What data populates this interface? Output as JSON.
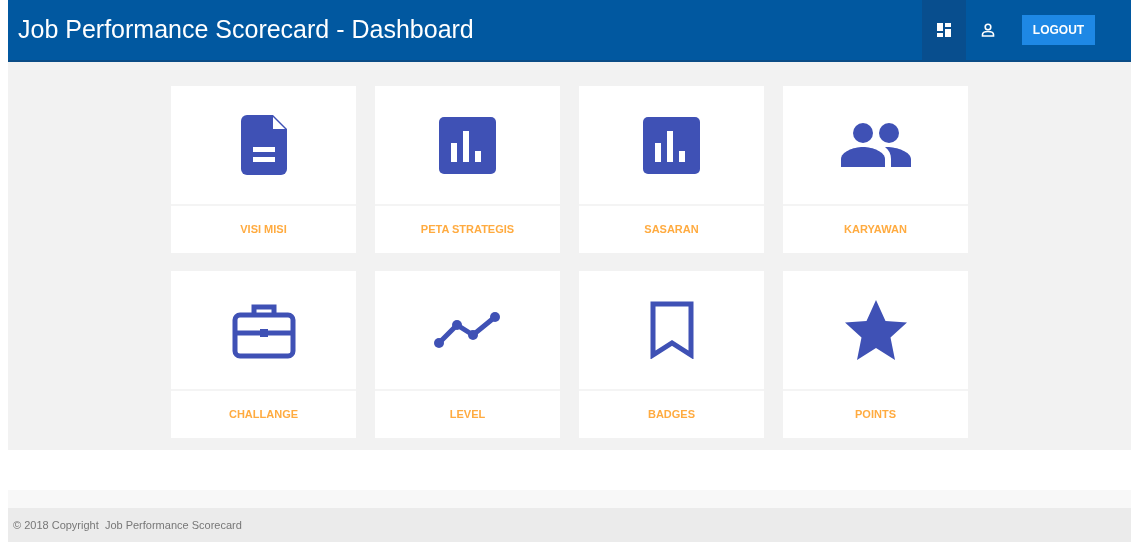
{
  "header": {
    "title": "Job Performance Scorecard - Dashboard",
    "nav": [
      {
        "selected": true
      },
      {
        "selected": false
      }
    ],
    "logout": "LOGOUT"
  },
  "tiles": [
    {
      "label": "VISI MISI"
    },
    {
      "label": "PETA STRATEGIS"
    },
    {
      "label": "SASARAN"
    },
    {
      "label": "KARYAWAN"
    },
    {
      "label": "CHALLANGE"
    },
    {
      "label": "LEVEL"
    },
    {
      "label": "BADGES"
    },
    {
      "label": "POINTS"
    }
  ],
  "footer": {
    "text": "© 2018 Copyright  Job Performance Scorecard"
  }
}
